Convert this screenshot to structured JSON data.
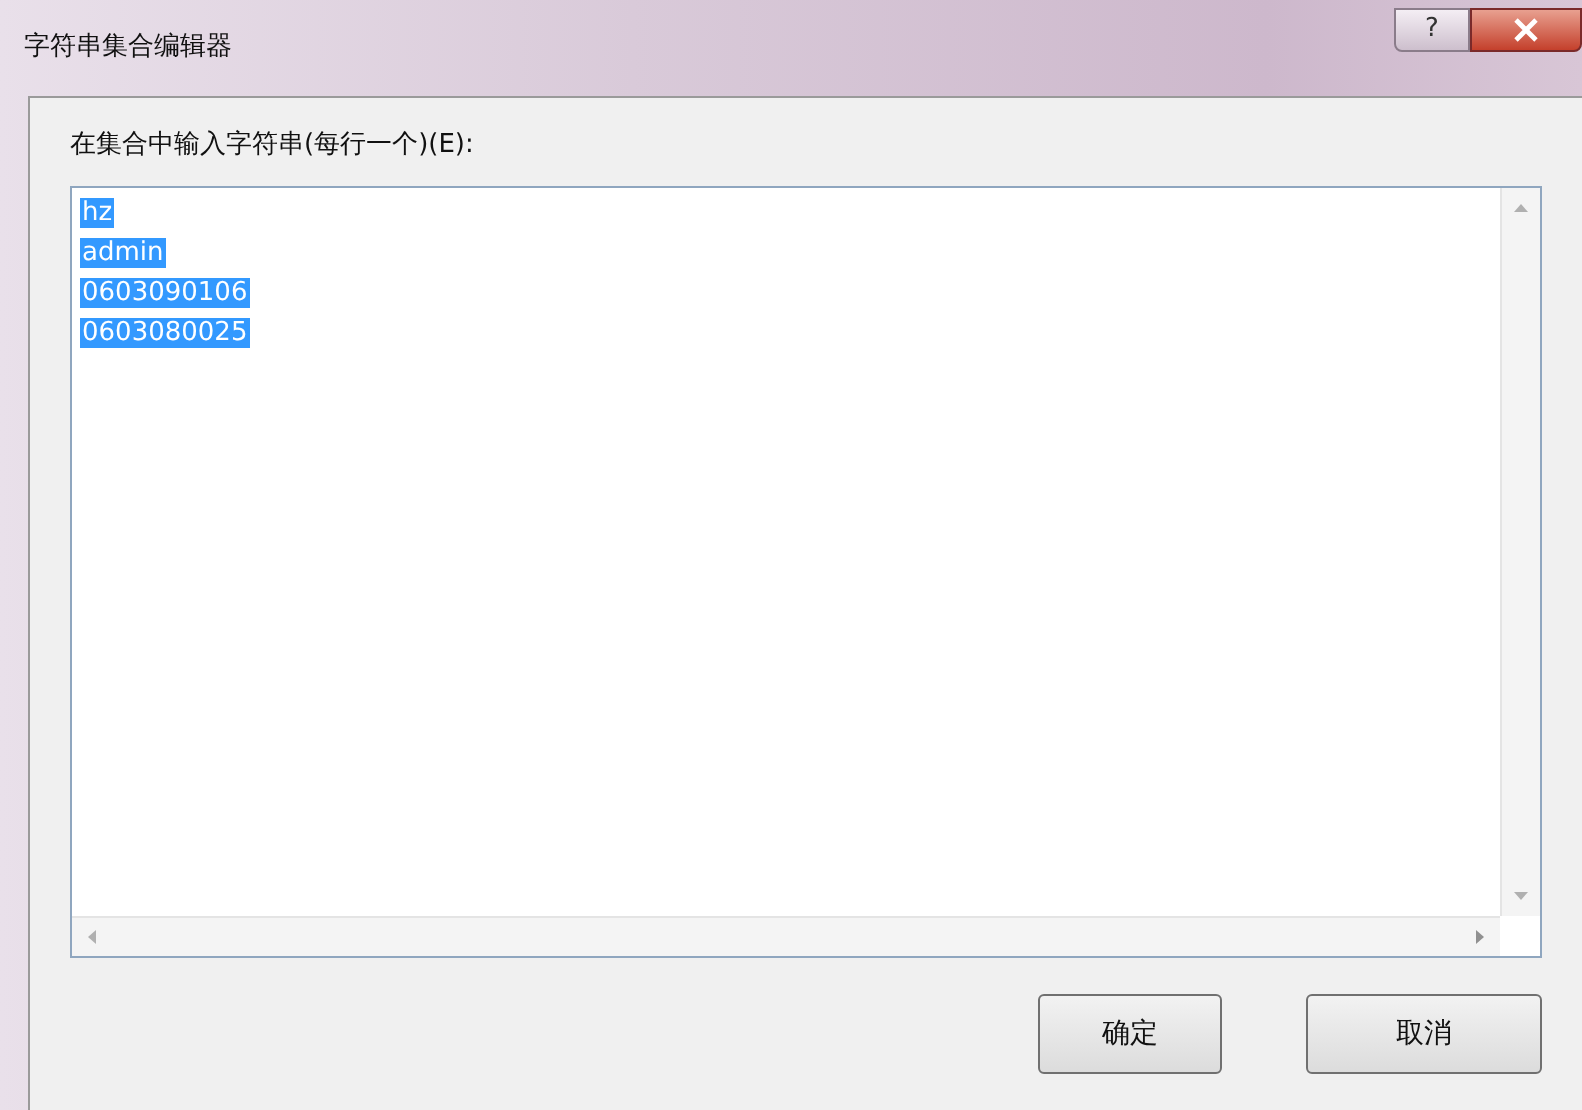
{
  "window": {
    "title": "字符串集合编辑器",
    "help": "?"
  },
  "prompt": "在集合中输入字符串(每行一个)(E):",
  "lines": [
    {
      "text": "hz",
      "selected": true
    },
    {
      "text": "admin",
      "selected": true
    },
    {
      "text": "0603090106",
      "selected": true
    },
    {
      "text": "0603080025",
      "selected": true
    }
  ],
  "buttons": [
    "确定",
    "取消"
  ]
}
